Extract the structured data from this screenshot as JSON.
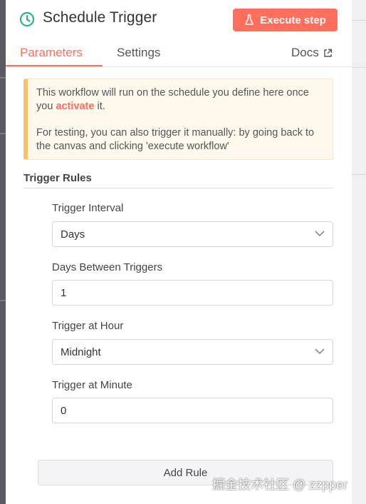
{
  "header": {
    "title": "Schedule Trigger",
    "execute_label": "Execute step"
  },
  "tabs": {
    "parameters": "Parameters",
    "settings": "Settings",
    "docs": "Docs"
  },
  "notice": {
    "line1_prefix": "This workflow will run on the schedule you define here once you ",
    "activate_link": "activate",
    "line1_suffix": " it.",
    "line2": "For testing, you can also trigger it manually: by going back to the canvas and clicking 'execute workflow'"
  },
  "trigger_rules": {
    "title": "Trigger Rules",
    "fields": [
      {
        "label": "Trigger Interval",
        "value": "Days"
      },
      {
        "label": "Days Between Triggers",
        "value": "1"
      },
      {
        "label": "Trigger at Hour",
        "value": "Midnight"
      },
      {
        "label": "Trigger at Minute",
        "value": "0"
      }
    ],
    "add_rule_label": "Add Rule"
  },
  "watermark": "掘金技术社区 @ zzpper",
  "colors": {
    "accent": "#ff6f5c",
    "trigger_icon": "#2bb28b",
    "notice_bg": "#fef8ed",
    "notice_border": "#f3c26a"
  },
  "icons": {
    "trigger": "clock-icon",
    "execute": "flask-icon",
    "docs": "external-link-icon",
    "dropdown": "chevron-down-icon"
  }
}
